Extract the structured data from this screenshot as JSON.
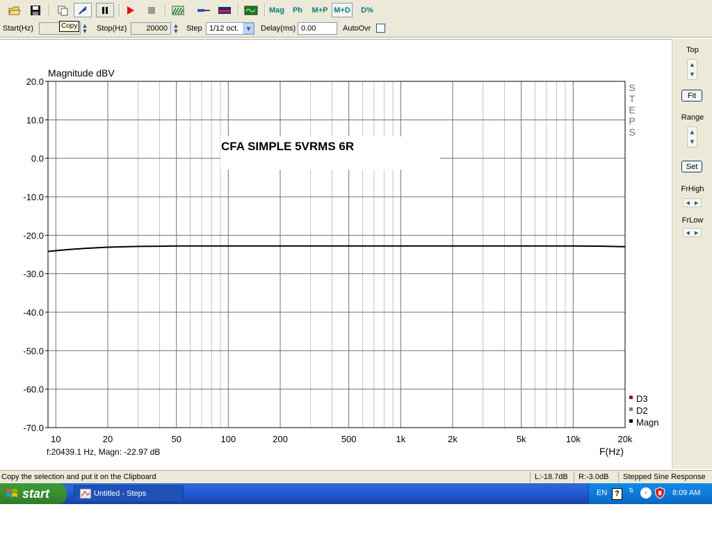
{
  "toolbar": {
    "mag_label": "Mag",
    "ph_label": "Ph",
    "mp_label": "M+P",
    "md_label": "M+D",
    "d_pct_label": "D%",
    "tooltip": "Copy"
  },
  "params": {
    "start_label": "Start(Hz)",
    "start_value": "",
    "stop_label": "Stop(Hz)",
    "stop_value": "20000",
    "step_label": "Step",
    "step_value": "1/12 oct.",
    "delay_label": "Delay(ms)",
    "delay_value": "0.00",
    "autoovr_label": "AutoOvr"
  },
  "right_panel": {
    "top_label": "Top",
    "fit_label": "Fit",
    "range_label": "Range",
    "set_label": "Set",
    "frhigh_label": "FrHigh",
    "frlow_label": "FrLow"
  },
  "chart_data": {
    "type": "line",
    "title": "CFA SIMPLE 5VRMS 6R",
    "ylabel": "Magnitude dBV",
    "xlabel": "F(Hz)",
    "x_scale": "log",
    "xlim": [
      9,
      20000
    ],
    "ylim": [
      -70,
      20
    ],
    "grid": true,
    "legend_position": "bottom-right",
    "y_ticks": [
      "20.0",
      "10.0",
      "0.0",
      "-10.0",
      "-20.0",
      "-30.0",
      "-40.0",
      "-50.0",
      "-60.0",
      "-70.0"
    ],
    "x_ticks": [
      {
        "value": 10,
        "label": "10"
      },
      {
        "value": 20,
        "label": "20"
      },
      {
        "value": 50,
        "label": "50"
      },
      {
        "value": 100,
        "label": "100"
      },
      {
        "value": 200,
        "label": "200"
      },
      {
        "value": 500,
        "label": "500"
      },
      {
        "value": 1000,
        "label": "1k"
      },
      {
        "value": 2000,
        "label": "2k"
      },
      {
        "value": 5000,
        "label": "5k"
      },
      {
        "value": 10000,
        "label": "10k"
      },
      {
        "value": 20000,
        "label": "20k"
      }
    ],
    "series": [
      {
        "name": "Magn",
        "color": "#000000",
        "x": [
          9,
          10,
          12,
          15,
          20,
          25,
          30,
          40,
          50,
          70,
          100,
          200,
          500,
          1000,
          2000,
          5000,
          10000,
          15000,
          20000
        ],
        "values": [
          -24.2,
          -24.0,
          -23.7,
          -23.4,
          -23.1,
          -23.0,
          -22.9,
          -22.85,
          -22.8,
          -22.8,
          -22.8,
          -22.8,
          -22.8,
          -22.8,
          -22.8,
          -22.8,
          -22.8,
          -22.85,
          -22.97
        ]
      }
    ],
    "legend": [
      {
        "name": "D3",
        "color": "#8b1a1a"
      },
      {
        "name": "D2",
        "color": "#808080"
      },
      {
        "name": "Magn",
        "color": "#000000"
      }
    ],
    "side_label": [
      "S",
      "T",
      "E",
      "P",
      "S"
    ],
    "readout": "f:20439.1 Hz, Magn: -22.97 dB"
  },
  "status": {
    "message": "Copy the selection and put it on the Clipboard",
    "left_level": "L:-18.7dB",
    "right_level": "R:-3.0dB",
    "mode": "Stepped Sine Response"
  },
  "taskbar": {
    "start_label": "start",
    "window_label": "Untitled - Steps",
    "lang": "EN",
    "clock": "8:09 AM"
  }
}
